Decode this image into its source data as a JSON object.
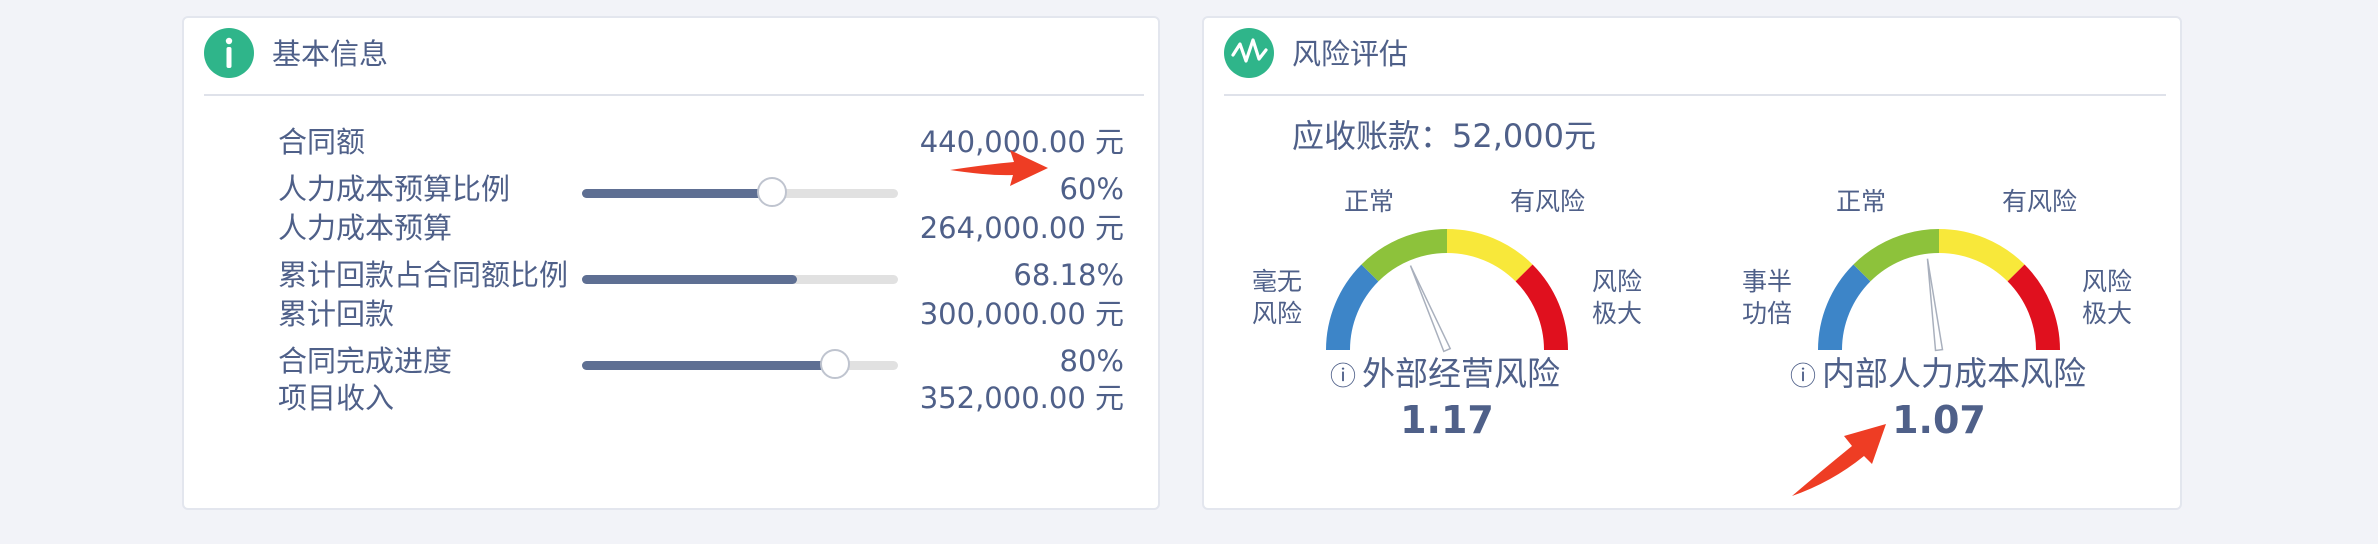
{
  "basic": {
    "title": "基本信息",
    "rows": [
      {
        "label": "合同额",
        "value": "440,000.00 元"
      },
      {
        "label": "人力成本预算比例",
        "value": "60%",
        "progress": 0.6
      },
      {
        "label": "人力成本预算",
        "value": "264,000.00 元"
      },
      {
        "label": "累计回款占合同额比例",
        "value": "68.18%",
        "progress": 0.6818
      },
      {
        "label": "累计回款",
        "value": "300,000.00 元"
      },
      {
        "label": "合同完成进度",
        "value": "80%",
        "progress": 0.8
      },
      {
        "label": "项目收入",
        "value": "352,000.00 元"
      }
    ]
  },
  "risk": {
    "title": "风险评估",
    "receivable": "应收账款：52,000元",
    "gauges": [
      {
        "left_label_line1": "毫无",
        "left_label_line2": "风险",
        "normal_label": "正常",
        "risk_label": "有风险",
        "right_label_line1": "风险",
        "right_label_line2": "极大",
        "info_icon": "ⓘ",
        "title": "外部经营风险",
        "value": "1.17",
        "needle_fraction": 0.37
      },
      {
        "left_label_line1": "事半",
        "left_label_line2": "功倍",
        "normal_label": "正常",
        "risk_label": "有风险",
        "right_label_line1": "风险",
        "right_label_line2": "极大",
        "info_icon": "ⓘ",
        "title": "内部人力成本风险",
        "value": "1.07",
        "needle_fraction": 0.46
      }
    ]
  },
  "colors": {
    "accent": "#2fb58a",
    "text": "#4f6089",
    "slider_fill": "#5e6f93",
    "arrow": "#ee3d24",
    "gauge_segments": [
      "#3d85c8",
      "#8dc23b",
      "#f8e83a",
      "#e0101e"
    ]
  }
}
